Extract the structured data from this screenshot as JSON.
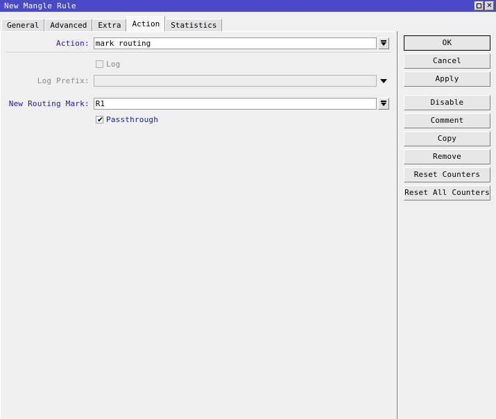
{
  "window": {
    "title": "New Mangle Rule",
    "controls": [
      {
        "name": "maximize-button",
        "glyph": ""
      },
      {
        "name": "close-button",
        "glyph": "✕"
      }
    ]
  },
  "tabs": [
    {
      "label": "General",
      "active": false
    },
    {
      "label": "Advanced",
      "active": false
    },
    {
      "label": "Extra",
      "active": false
    },
    {
      "label": "Action",
      "active": true
    },
    {
      "label": "Statistics",
      "active": false
    }
  ],
  "form": {
    "action": {
      "label": "Action:",
      "value": "mark routing",
      "placeholder": ""
    },
    "log": {
      "label": "Log",
      "checked": false,
      "enabled": false
    },
    "log_prefix": {
      "label": "Log Prefix:",
      "value": "",
      "placeholder": "",
      "enabled": false
    },
    "new_routing_mark": {
      "label": "New Routing Mark:",
      "value": "R1",
      "placeholder": ""
    },
    "passthrough": {
      "label": "Passthrough",
      "checked": true,
      "mark": "✔"
    }
  },
  "buttons": [
    {
      "label": "OK",
      "name": "ok-button",
      "default": true
    },
    {
      "label": "Cancel",
      "name": "cancel-button",
      "default": false
    },
    {
      "label": "Apply",
      "name": "apply-button",
      "default": false
    },
    {
      "label": "Disable",
      "name": "disable-button",
      "default": false
    },
    {
      "label": "Comment",
      "name": "comment-button",
      "default": false
    },
    {
      "label": "Copy",
      "name": "copy-button",
      "default": false
    },
    {
      "label": "Remove",
      "name": "remove-button",
      "default": false
    },
    {
      "label": "Reset Counters",
      "name": "reset-counters-button",
      "default": false
    },
    {
      "label": "Reset All Counters",
      "name": "reset-all-counters-button",
      "default": false
    }
  ],
  "colors": {
    "titlebar": "#4a4ac8",
    "label_active": "#1a1aa8",
    "label_disabled": "#8a8a8a",
    "panel": "#efefef"
  }
}
